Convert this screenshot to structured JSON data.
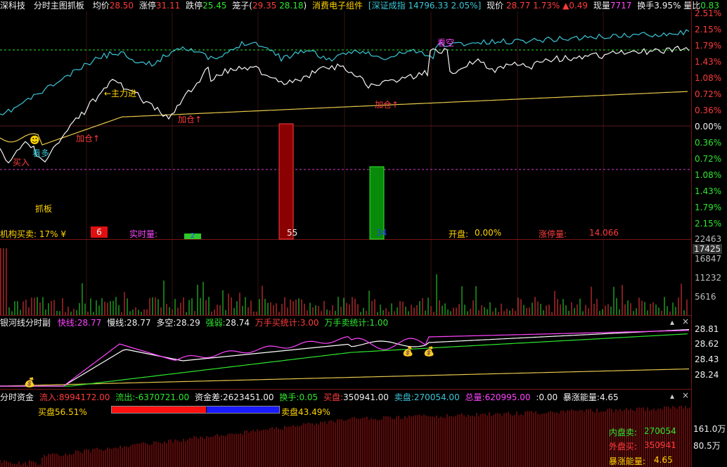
{
  "header": {
    "stock": "深科技",
    "indicator": "分时主图抓板",
    "avg_label": "均价",
    "avg_value": "28.50",
    "limit_up_label": "涨停",
    "limit_up_value": "31.11",
    "limit_down_label": "跌停",
    "limit_down_value": "25.45",
    "cage_label": "笼子(",
    "cage_low": "29.35",
    "cage_high": "28.18",
    "cage_close": ")",
    "sector": "消费电子组件",
    "index_text": "[深证成指 14796.33 2.05%]",
    "price_label": "现价",
    "price_value": "28.77",
    "pct_value": "1.73%",
    "change_value": "▲0.49",
    "vol_label": "现量",
    "vol_value": "7717",
    "turnover_label": "换手",
    "turnover_value": "3.95%",
    "vol_ratio_label": "量比",
    "vol_ratio_value": "0.83"
  },
  "main_axis": [
    "2.51%",
    "2.15%",
    "1.79%",
    "1.43%",
    "1.08%",
    "0.72%",
    "0.36%",
    "0.00%",
    "0.36%",
    "0.72%",
    "1.08%",
    "1.43%",
    "1.79%",
    "2.15%"
  ],
  "main_annotations": {
    "main_force": "←主力进",
    "add1": "加仓↑",
    "add2": "加仓↑",
    "add3": "加仓↑",
    "buy": "买入",
    "watch": "看多",
    "sell_hint": "看空",
    "grab": "抓板"
  },
  "main_bottom": {
    "inst_label": "机构买卖: 17% ¥",
    "box6": "6",
    "realtime_label": "实时量:",
    "small_val": "2",
    "val55": "55",
    "val34": "34",
    "open_label": "开盘:",
    "open_value": "0.00%",
    "limit_amt_label": "涨停量:",
    "limit_amt_value": "14.066"
  },
  "volume_axis": [
    "22463",
    "17425",
    "16847",
    "11232",
    "5616"
  ],
  "ma_panel": {
    "title": "银河线分时副",
    "fast_label": "快线:",
    "fast_value": "28.77",
    "slow_label": "慢线:",
    "slow_value": "28.77",
    "bull_label": "多空:",
    "bull_value": "28.29",
    "strong_label": "强弱:",
    "strong_value": "28.74",
    "buy_stat_label": "万手买统计:",
    "buy_stat_value": "3.00",
    "sell_stat_label": "万手卖统计:",
    "sell_stat_value": "1.00",
    "axis": [
      "28.81",
      "28.62",
      "28.43",
      "28.24"
    ]
  },
  "fund_panel": {
    "title": "分时资金",
    "in_label": "流入:",
    "in_value": "8994172.00",
    "out_label": "流出:",
    "out_value": "-6370721.00",
    "diff_label": "资金差:",
    "diff_value": "2623451.00",
    "turn_label": "换手:",
    "turn_value": "0.05",
    "buy_label": "买盘:",
    "buy_value": "350941.00",
    "sell_label": "卖盘:",
    "sell_value": "270054.00",
    "total_label": "总量:",
    "total_value": "620995.00",
    "zero_label": ":",
    "zero_value": "0.00",
    "surge_label": "暴涨能量:",
    "surge_value": "4.65",
    "buy_pct": "买盘56.51%",
    "sell_pct": "卖盘43.49%",
    "inner_label": "内盘卖:",
    "inner_value": "270054",
    "outer_label": "外盘买:",
    "outer_value": "350941",
    "surge2_label": "暴涨能量:",
    "surge2_value": "4.65",
    "axis": [
      "161.0万",
      "80.5万"
    ]
  },
  "colors": {
    "up": "#ff3b3b",
    "down": "#2ee62e",
    "price_line": "#ffffff",
    "index_line": "#39c6d6",
    "avg_line": "#e6c84a",
    "grid_border": "#7a1414"
  }
}
